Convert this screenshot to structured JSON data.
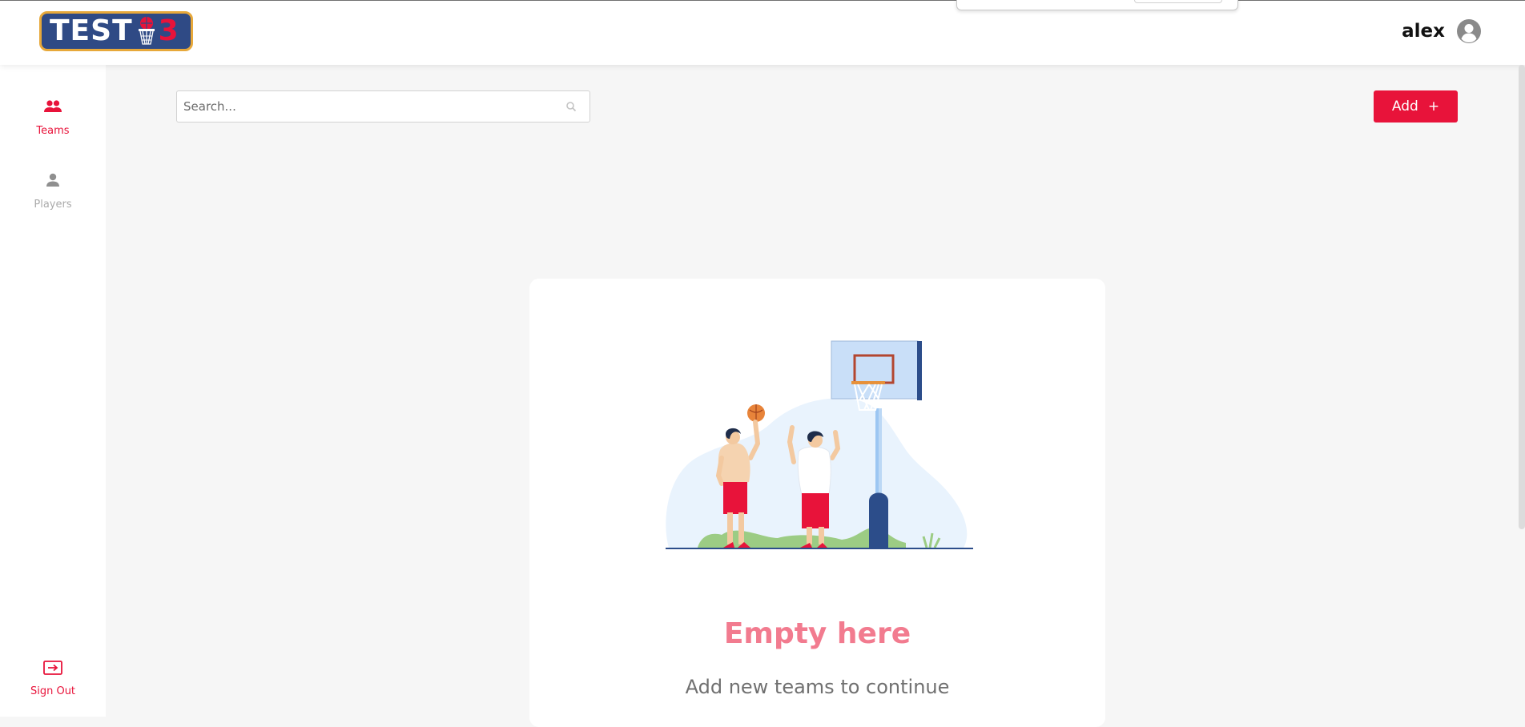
{
  "header": {
    "logo_text": "TEST",
    "logo_number": "3",
    "username": "alex"
  },
  "sidebar": {
    "items": [
      {
        "label": "Teams",
        "icon": "teams-icon",
        "active": true
      },
      {
        "label": "Players",
        "icon": "player-icon",
        "active": false
      }
    ],
    "signout_label": "Sign Out"
  },
  "search": {
    "placeholder": "Search..."
  },
  "add_button": {
    "label": "Add",
    "icon": "+"
  },
  "empty_state": {
    "title": "Empty here",
    "subtitle": "Add new teams to continue"
  },
  "colors": {
    "accent": "#e8133a",
    "empty_title": "#f27b8f",
    "logo_bg": "#2f4a85",
    "logo_border": "#e7a83a",
    "inactive": "#aaaaaa"
  }
}
